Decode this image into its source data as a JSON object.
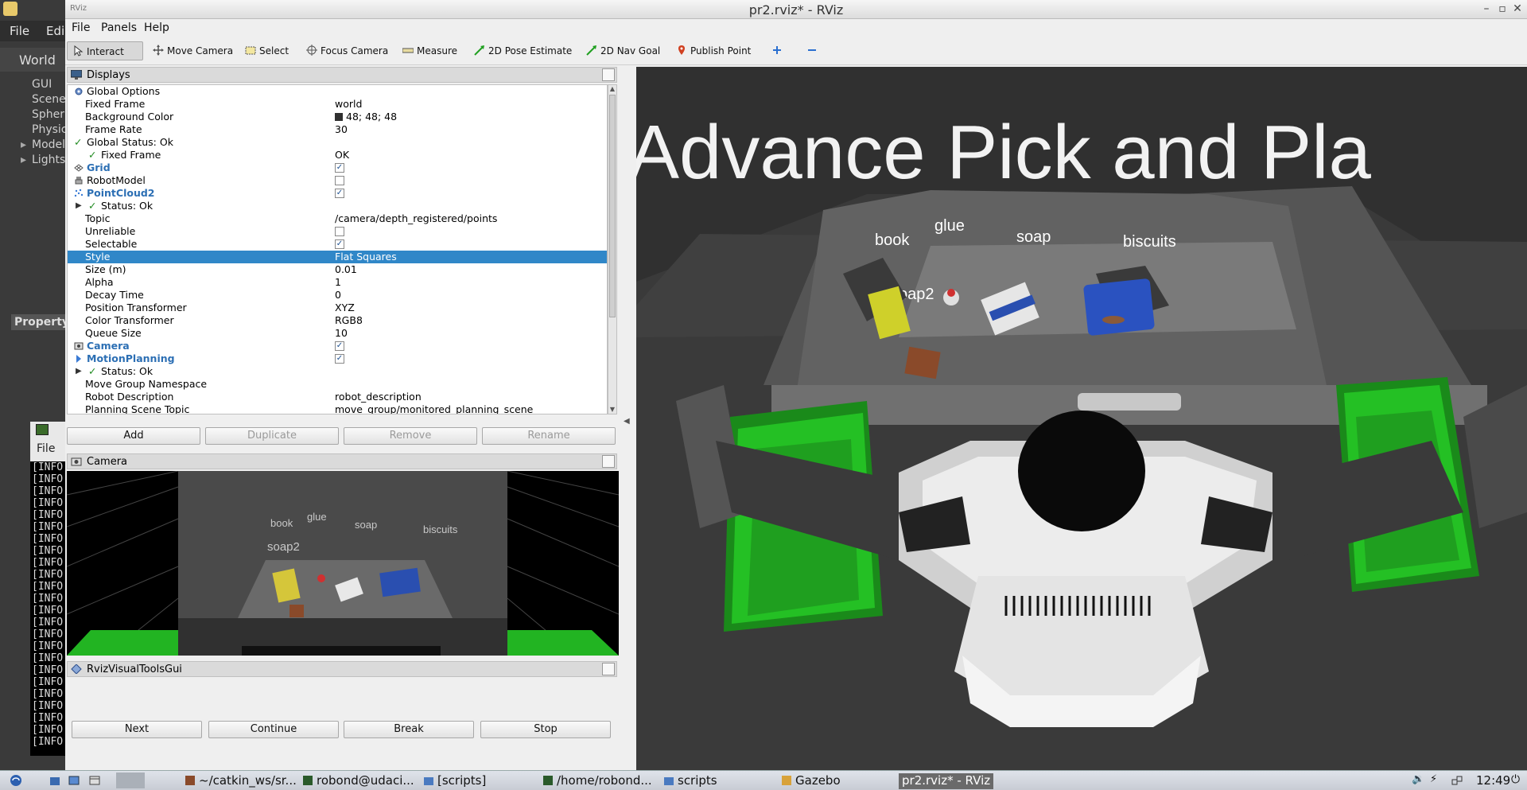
{
  "window": {
    "title": "pr2.rviz* - RViz"
  },
  "gazebo_behind": {
    "menu": [
      "File",
      "Edi"
    ],
    "world_label": "World",
    "tree_items": [
      "GUI",
      "Scene",
      "Spher",
      "Physic",
      "Model",
      "Lights"
    ],
    "property_label": "Property"
  },
  "terminal_behind": {
    "menu_file": "File",
    "lines": [
      "[INFO",
      "[INFO",
      "[INFO",
      "[INFO",
      "[INFO",
      "[INFO",
      "[INFO",
      "[INFO",
      "[INFO",
      "[INFO",
      "[INFO",
      "[INFO",
      "[INFO",
      "[INFO",
      "[INFO",
      "[INFO",
      "[INFO",
      "[INFO",
      "[INFO",
      "[INFO",
      "[INFO",
      "[INFO",
      "[INFO",
      "[INFO"
    ]
  },
  "menubar": {
    "file": "File",
    "panels": "Panels",
    "help": "Help"
  },
  "toolbar": {
    "interact": "Interact",
    "move_camera": "Move Camera",
    "select": "Select",
    "focus_camera": "Focus Camera",
    "measure": "Measure",
    "pose_estimate": "2D Pose Estimate",
    "nav_goal": "2D Nav Goal",
    "publish_point": "Publish Point"
  },
  "displays": {
    "title": "Displays",
    "rows": [
      {
        "key": "Global Options",
        "value": ""
      },
      {
        "key": "Fixed Frame",
        "value": "world"
      },
      {
        "key": "Background Color",
        "value": "48; 48; 48"
      },
      {
        "key": "Frame Rate",
        "value": "30"
      },
      {
        "key": "Global Status: Ok",
        "value": ""
      },
      {
        "key": "Fixed Frame",
        "value": "OK"
      },
      {
        "key": "Grid",
        "value": ""
      },
      {
        "key": "RobotModel",
        "value": ""
      },
      {
        "key": "PointCloud2",
        "value": ""
      },
      {
        "key": "Status: Ok",
        "value": ""
      },
      {
        "key": "Topic",
        "value": "/camera/depth_registered/points"
      },
      {
        "key": "Unreliable",
        "value": ""
      },
      {
        "key": "Selectable",
        "value": ""
      },
      {
        "key": "Style",
        "value": "Flat Squares"
      },
      {
        "key": "Size (m)",
        "value": "0.01"
      },
      {
        "key": "Alpha",
        "value": "1"
      },
      {
        "key": "Decay Time",
        "value": "0"
      },
      {
        "key": "Position Transformer",
        "value": "XYZ"
      },
      {
        "key": "Color Transformer",
        "value": "RGB8"
      },
      {
        "key": "Queue Size",
        "value": "10"
      },
      {
        "key": "Camera",
        "value": ""
      },
      {
        "key": "MotionPlanning",
        "value": ""
      },
      {
        "key": "Status: Ok",
        "value": ""
      },
      {
        "key": "Move Group Namespace",
        "value": ""
      },
      {
        "key": "Robot Description",
        "value": "robot_description"
      },
      {
        "key": "Planning Scene Topic",
        "value": "move_group/monitored_planning_scene"
      }
    ],
    "checks": {
      "grid": true,
      "robot_model": false,
      "pointcloud2": true,
      "unreliable": false,
      "selectable": true,
      "camera": true,
      "motion_planning": true
    },
    "buttons": {
      "add": "Add",
      "duplicate": "Duplicate",
      "remove": "Remove",
      "rename": "Rename"
    }
  },
  "camera_panel": {
    "title": "Camera",
    "labels": {
      "book": "book",
      "glue": "glue",
      "soap": "soap",
      "biscuits": "biscuits",
      "soap2": "soap2"
    }
  },
  "rviz_visual_tools": {
    "title": "RvizVisualToolsGui",
    "buttons": {
      "next": "Next",
      "continue": "Continue",
      "break": "Break",
      "stop": "Stop"
    }
  },
  "scene": {
    "banner": "Advance  Pick  and  Pla",
    "labels": {
      "book": "book",
      "glue": "glue",
      "soap": "soap",
      "biscuits": "biscuits",
      "soap2": "soap2"
    }
  },
  "taskbar": {
    "items": [
      "~/catkin_ws/sr...",
      "robond@udaci...",
      "[scripts]",
      "/home/robond...",
      "scripts",
      "Gazebo",
      "pr2.rviz* - RViz"
    ],
    "clock": "12:49"
  },
  "colors": {
    "background": "#303030",
    "selection": "#3087c8",
    "category": "#2c6fb4",
    "bin_green": "#22c022",
    "status_ok": "#1f8a1f"
  }
}
